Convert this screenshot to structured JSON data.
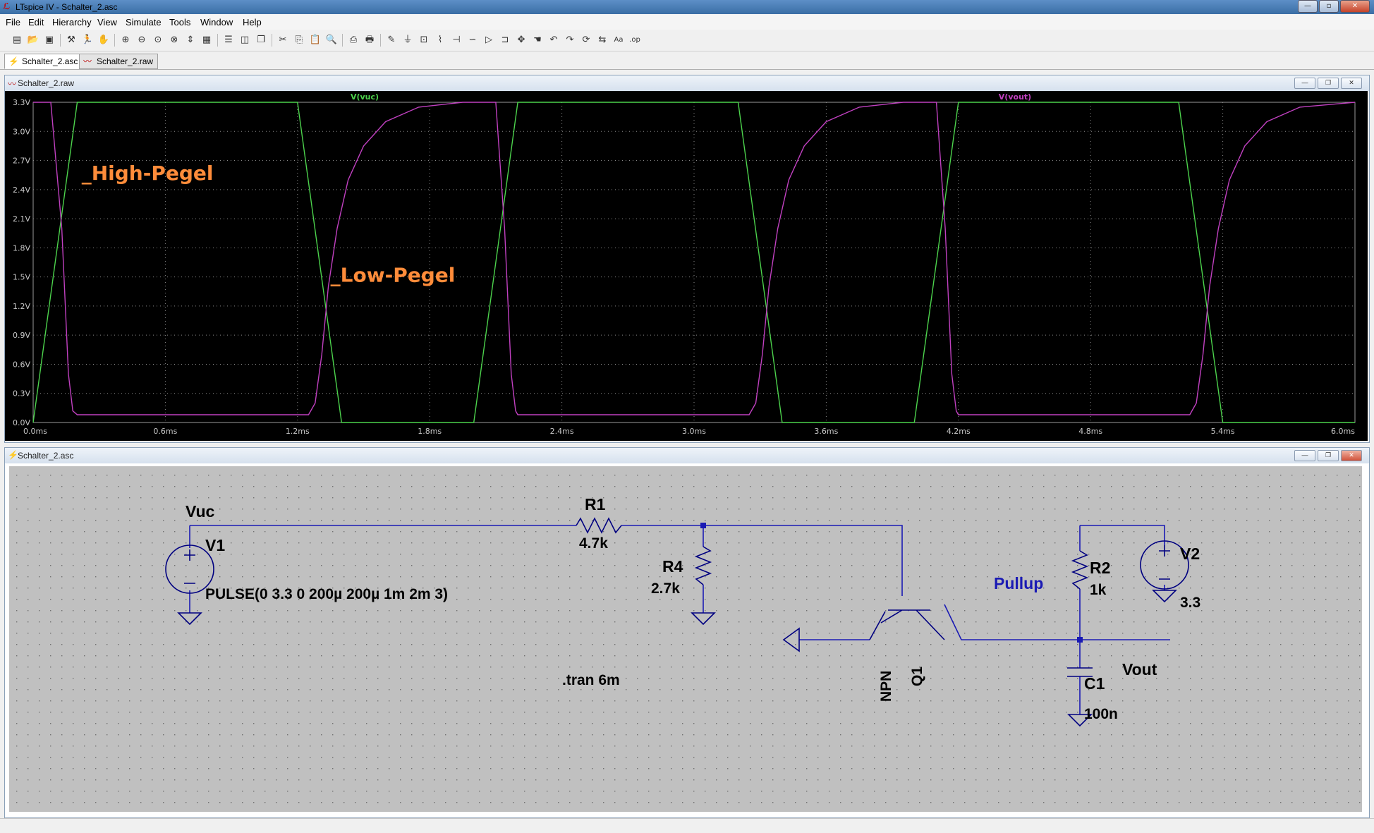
{
  "window": {
    "title": "LTspice IV - Schalter_2.asc",
    "minimize": "—",
    "maximize": "▫",
    "close": "✕"
  },
  "menu": [
    "File",
    "Edit",
    "Hierarchy",
    "View",
    "Simulate",
    "Tools",
    "Window",
    "Help"
  ],
  "toolbar_icons": [
    "new-schematic-icon",
    "open-icon",
    "save-icon",
    "control-panel-icon",
    "run-icon",
    "halt-icon",
    "zoom-in-icon",
    "zoom-out-icon",
    "zoom-full-icon",
    "zoom-cancel-icon",
    "autorange-icon",
    "grid-icon",
    "tile-horizontal-icon",
    "tile-vertical-icon",
    "cascade-icon",
    "cut-icon",
    "copy-icon",
    "paste-icon",
    "find-icon",
    "print-setup-icon",
    "print-icon",
    "wire-icon",
    "ground-icon",
    "label-icon",
    "resistor-icon",
    "capacitor-icon",
    "inductor-icon",
    "diode-icon",
    "component-icon",
    "move-icon",
    "drag-icon",
    "undo-icon",
    "redo-icon",
    "rotate-icon",
    "mirror-icon",
    "text-icon",
    "spice-directive-icon"
  ],
  "tabs": [
    {
      "label": "Schalter_2.asc",
      "icon": "schematic-icon",
      "active": true
    },
    {
      "label": "Schalter_2.raw",
      "icon": "waveform-icon",
      "active": false
    }
  ],
  "plot_window": {
    "title": "Schalter_2.raw",
    "minimize": "—",
    "restore": "❐",
    "close": "✕"
  },
  "schematic_window": {
    "title": "Schalter_2.asc",
    "minimize": "—",
    "restore": "❐",
    "close": "✕"
  },
  "chart_data": {
    "type": "line",
    "ylim": [
      0,
      3.3
    ],
    "xlim": [
      0,
      6.0
    ],
    "y_ticks": [
      "3.3V",
      "3.0V",
      "2.7V",
      "2.4V",
      "2.1V",
      "1.8V",
      "1.5V",
      "1.2V",
      "0.9V",
      "0.6V",
      "0.3V",
      "0.0V"
    ],
    "x_ticks": [
      "0.0ms",
      "0.6ms",
      "1.2ms",
      "1.8ms",
      "2.4ms",
      "3.0ms",
      "3.6ms",
      "4.2ms",
      "4.8ms",
      "5.4ms",
      "6.0ms"
    ],
    "grid": true,
    "series": [
      {
        "name": "V(vuc)",
        "color": "#4cd24c",
        "x": [
          0,
          0.2,
          1.2,
          1.4,
          2.0,
          2.2,
          3.2,
          3.4,
          4.0,
          4.2,
          5.2,
          5.4,
          6.0
        ],
        "y": [
          0,
          3.3,
          3.3,
          0,
          0,
          3.3,
          3.3,
          0,
          0,
          3.3,
          3.3,
          0,
          0
        ]
      },
      {
        "name": "V(vout)",
        "color": "#c040c0",
        "x": [
          0,
          0.08,
          0.13,
          0.16,
          0.18,
          0.2,
          1.25,
          1.28,
          1.31,
          1.34,
          1.38,
          1.43,
          1.5,
          1.6,
          1.75,
          1.95,
          2.1,
          2.14,
          2.17,
          2.19,
          2.2,
          3.25,
          3.28,
          3.31,
          3.34,
          3.38,
          3.43,
          3.5,
          3.6,
          3.75,
          3.95,
          4.1,
          4.14,
          4.17,
          4.19,
          4.2,
          5.25,
          5.28,
          5.31,
          5.34,
          5.38,
          5.43,
          5.5,
          5.6,
          5.75,
          6.0
        ],
        "y": [
          3.3,
          3.3,
          2.0,
          0.5,
          0.12,
          0.08,
          0.08,
          0.2,
          0.7,
          1.4,
          2.0,
          2.5,
          2.85,
          3.1,
          3.25,
          3.3,
          3.3,
          2.0,
          0.5,
          0.12,
          0.08,
          0.08,
          0.2,
          0.7,
          1.4,
          2.0,
          2.5,
          2.85,
          3.1,
          3.25,
          3.3,
          3.3,
          2.0,
          0.5,
          0.12,
          0.08,
          0.08,
          0.2,
          0.7,
          1.4,
          2.0,
          2.5,
          2.85,
          3.1,
          3.25,
          3.3
        ]
      }
    ],
    "annotations": [
      {
        "text": "_High-Pegel",
        "color": "#ff8c3a",
        "x": 0.22,
        "y": 2.5
      },
      {
        "text": "_Low-Pegel",
        "color": "#ff8c3a",
        "x": 1.35,
        "y": 1.45
      }
    ]
  },
  "schematic": {
    "net_vuc": "Vuc",
    "v1_name": "V1",
    "v1_value": "PULSE(0 3.3 0 200µ 200µ 1m 2m 3)",
    "r1_name": "R1",
    "r1_value": "4.7k",
    "r4_name": "R4",
    "r4_value": "2.7k",
    "q1_name": "Q1",
    "q1_model": "NPN",
    "r2_name": "R2",
    "r2_value": "1k",
    "v2_name": "V2",
    "v2_value": "3.3",
    "c1_name": "C1",
    "c1_value": "100n",
    "net_vout": "Vout",
    "pullup_comment": "Pullup",
    "directive": ".tran 6m",
    "wire_color": "#1a1ab4",
    "component_color": "#000080",
    "background": "#c0c0c0",
    "comment_color": "#1a1ab4"
  }
}
